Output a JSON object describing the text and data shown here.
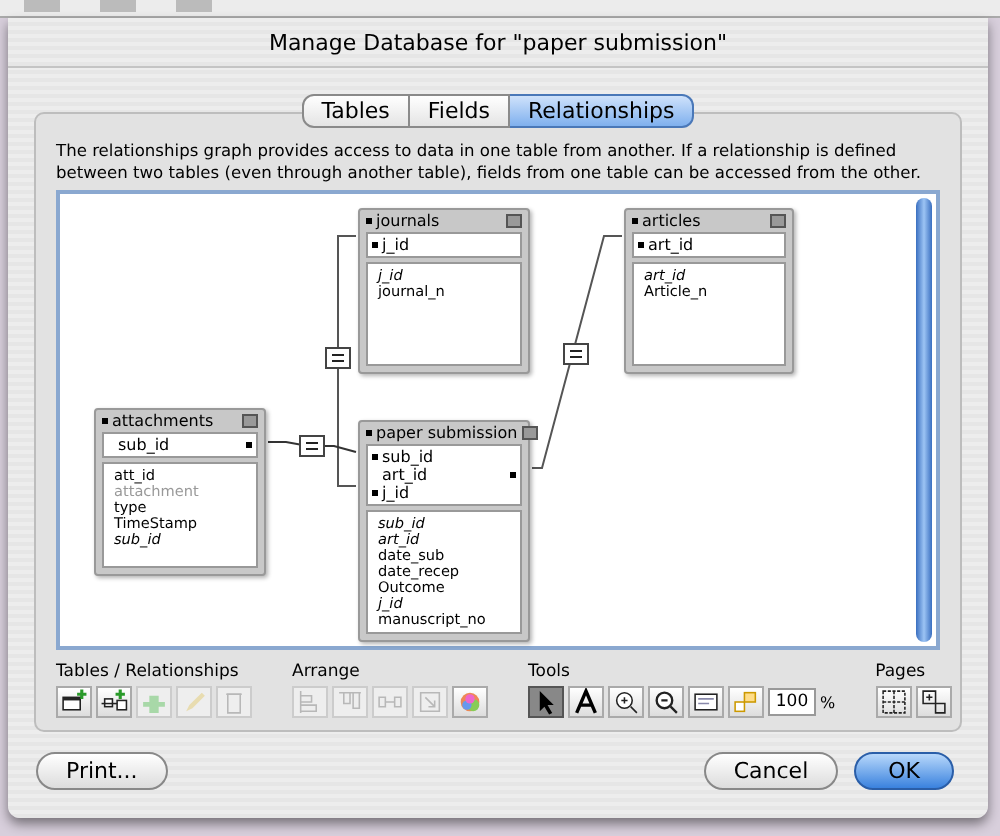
{
  "window": {
    "title": "Manage Database for \"paper submission\""
  },
  "tabs": [
    {
      "label": "Tables",
      "selected": false
    },
    {
      "label": "Fields",
      "selected": false
    },
    {
      "label": "Relationships",
      "selected": true
    }
  ],
  "description": "The relationships graph provides access to data in one table from another. If a relationship is defined between two tables (even through another table), fields from one table can be accessed from the other.",
  "graph": {
    "tables": [
      {
        "name": "journals",
        "keys": [
          {
            "name": "j_id",
            "kind": "left"
          }
        ],
        "fields": [
          {
            "name": "j_id",
            "kind": "italic"
          },
          {
            "name": "journal_n",
            "kind": "plain"
          }
        ]
      },
      {
        "name": "articles",
        "keys": [
          {
            "name": "art_id",
            "kind": "left"
          }
        ],
        "fields": [
          {
            "name": "art_id",
            "kind": "italic"
          },
          {
            "name": "Article_n",
            "kind": "plain"
          }
        ]
      },
      {
        "name": "attachments",
        "keys": [
          {
            "name": "sub_id",
            "kind": "right"
          }
        ],
        "fields": [
          {
            "name": "att_id",
            "kind": "plain"
          },
          {
            "name": "attachment",
            "kind": "dimmed"
          },
          {
            "name": "type",
            "kind": "plain"
          },
          {
            "name": "TimeStamp",
            "kind": "plain"
          },
          {
            "name": "sub_id",
            "kind": "italic"
          }
        ]
      },
      {
        "name": "paper submission",
        "keys": [
          {
            "name": "sub_id",
            "kind": "left"
          },
          {
            "name": "art_id",
            "kind": "right"
          },
          {
            "name": "j_id",
            "kind": "left"
          }
        ],
        "fields": [
          {
            "name": "sub_id",
            "kind": "italic"
          },
          {
            "name": "art_id",
            "kind": "italic"
          },
          {
            "name": "date_sub",
            "kind": "plain"
          },
          {
            "name": "date_recep",
            "kind": "plain"
          },
          {
            "name": "Outcome",
            "kind": "plain"
          },
          {
            "name": "j_id",
            "kind": "italic"
          },
          {
            "name": "manuscript_no",
            "kind": "plain"
          }
        ]
      }
    ]
  },
  "toolbar": {
    "groups": [
      {
        "label": "Tables / Relationships",
        "buttons": [
          {
            "kind": "addtable",
            "disabled": false,
            "selected": false
          },
          {
            "kind": "addlink",
            "disabled": false,
            "selected": false
          },
          {
            "kind": "duplicate",
            "disabled": true,
            "selected": false
          },
          {
            "kind": "edit",
            "disabled": true,
            "selected": false
          },
          {
            "kind": "delete",
            "disabled": true,
            "selected": false
          }
        ]
      },
      {
        "label": "Arrange",
        "buttons": [
          {
            "kind": "alignleft",
            "disabled": true,
            "selected": false
          },
          {
            "kind": "aligntop",
            "disabled": true,
            "selected": false
          },
          {
            "kind": "distribute",
            "disabled": true,
            "selected": false
          },
          {
            "kind": "resize",
            "disabled": true,
            "selected": false
          },
          {
            "kind": "color",
            "disabled": false,
            "selected": false
          }
        ]
      },
      {
        "label": "Tools",
        "buttons": [
          {
            "kind": "pointer",
            "disabled": false,
            "selected": true
          },
          {
            "kind": "text",
            "disabled": false,
            "selected": false
          },
          {
            "kind": "zoomin",
            "disabled": false,
            "selected": false
          },
          {
            "kind": "zoomout",
            "disabled": false,
            "selected": false
          },
          {
            "kind": "view",
            "disabled": false,
            "selected": false
          },
          {
            "kind": "note",
            "disabled": false,
            "selected": false
          }
        ],
        "zoom": "100",
        "unit": "%"
      },
      {
        "label": "Pages",
        "buttons": [
          {
            "kind": "pagebreaks",
            "disabled": false,
            "selected": false
          },
          {
            "kind": "fitpage",
            "disabled": false,
            "selected": false
          }
        ]
      }
    ]
  },
  "buttons": [
    {
      "label": "Print...",
      "default": false
    },
    {
      "label": "Cancel",
      "default": false
    },
    {
      "label": "OK",
      "default": true
    }
  ]
}
